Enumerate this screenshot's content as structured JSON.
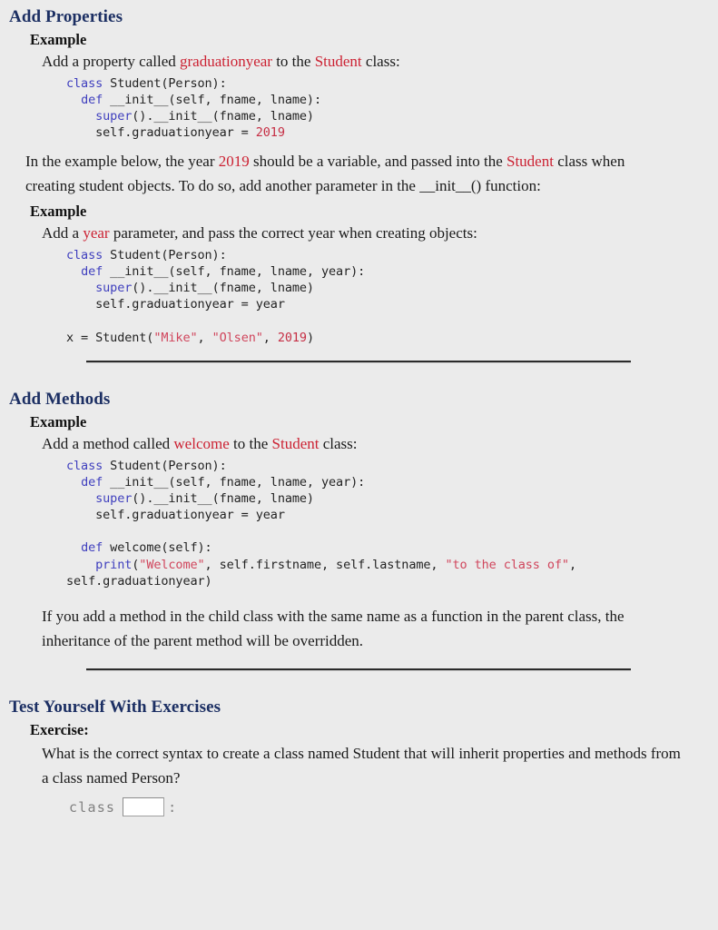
{
  "colors": {
    "background": "#ebebeb",
    "heading": "#1c2f63",
    "inline_red": "#cc2233",
    "code_keyword": "#3f3fbe",
    "code_string": "#d0455c",
    "code_number": "#c62f45",
    "divider": "#2b2b2b",
    "exercise_text": "#808080"
  },
  "sections": {
    "add_properties": {
      "heading": "Add Properties",
      "example_label": "Example",
      "lead_prefix": "Add a property called ",
      "lead_code1": "graduationyear",
      "lead_middle": " to the ",
      "lead_code2": "Student",
      "lead_suffix": " class:",
      "code": {
        "line1_kw": "class",
        "line1_rest": " Student(Person):",
        "line2_indent": "  ",
        "line2_kw": "def",
        "line2_rest": " __init__(self, fname, lname):",
        "line3_indent": "    ",
        "line3_kw": "super",
        "line3_rest": "().__init__(fname, lname)",
        "line4": "    self.graduationyear = ",
        "line4_num": "2019"
      }
    },
    "flow_paragraph": {
      "part1": "In the example below, the year ",
      "red1": "2019",
      "part2": " should be a variable, and passed into the ",
      "red2": "Student",
      "part3": " class when creating student objects. To do so, add another parameter in the __init__() function:"
    },
    "add_year_example": {
      "example_label": "Example",
      "lead_prefix": "Add a ",
      "lead_code1": "year",
      "lead_suffix": " parameter, and pass the correct year when creating objects:",
      "code": {
        "line1_kw": "class",
        "line1_rest": " Student(Person):",
        "line2_indent": "  ",
        "line2_kw": "def",
        "line2_rest": " __init__(self, fname, lname, year):",
        "line3_indent": "    ",
        "line3_kw": "super",
        "line3_rest": "().__init__(fname, lname)",
        "line4": "    self.graduationyear = year",
        "line6_pre": "x = Student(",
        "line6_str1": "\"Mike\"",
        "line6_mid1": ", ",
        "line6_str2": "\"Olsen\"",
        "line6_mid2": ", ",
        "line6_num": "2019",
        "line6_post": ")"
      }
    },
    "add_methods": {
      "heading": "Add Methods",
      "example_label": "Example",
      "lead_prefix": "Add a method called ",
      "lead_code1": "welcome",
      "lead_middle": " to the ",
      "lead_code2": "Student",
      "lead_suffix": " class:",
      "code": {
        "line1_kw": "class",
        "line1_rest": " Student(Person):",
        "line2_indent": "  ",
        "line2_kw": "def",
        "line2_rest": " __init__(self, fname, lname, year):",
        "line3_indent": "    ",
        "line3_kw": "super",
        "line3_rest": "().__init__(fname, lname)",
        "line4": "    self.graduationyear = year",
        "line6_indent": "  ",
        "line6_kw": "def",
        "line6_rest": " welcome(self):",
        "line7_indent": "    ",
        "line7_kw": "print",
        "line7_open": "(",
        "line7_str1": "\"Welcome\"",
        "line7_mid": ", self.firstname, self.lastname, ",
        "line7_str2": "\"to the class of\"",
        "line7_comma": ",",
        "line8": "self.graduationyear)"
      },
      "note": "If you add a method in the child class with the same name as a function in the parent class, the inheritance of the parent method will be overridden."
    },
    "test_yourself": {
      "heading": "Test Yourself With Exercises",
      "exercise_label": "Exercise:",
      "question": "What is the correct syntax to create a class named Student that will inherit properties and methods from a class named Person?",
      "answer_prefix": "class",
      "answer_value": "",
      "answer_placeholder": "",
      "answer_suffix": ":"
    }
  }
}
